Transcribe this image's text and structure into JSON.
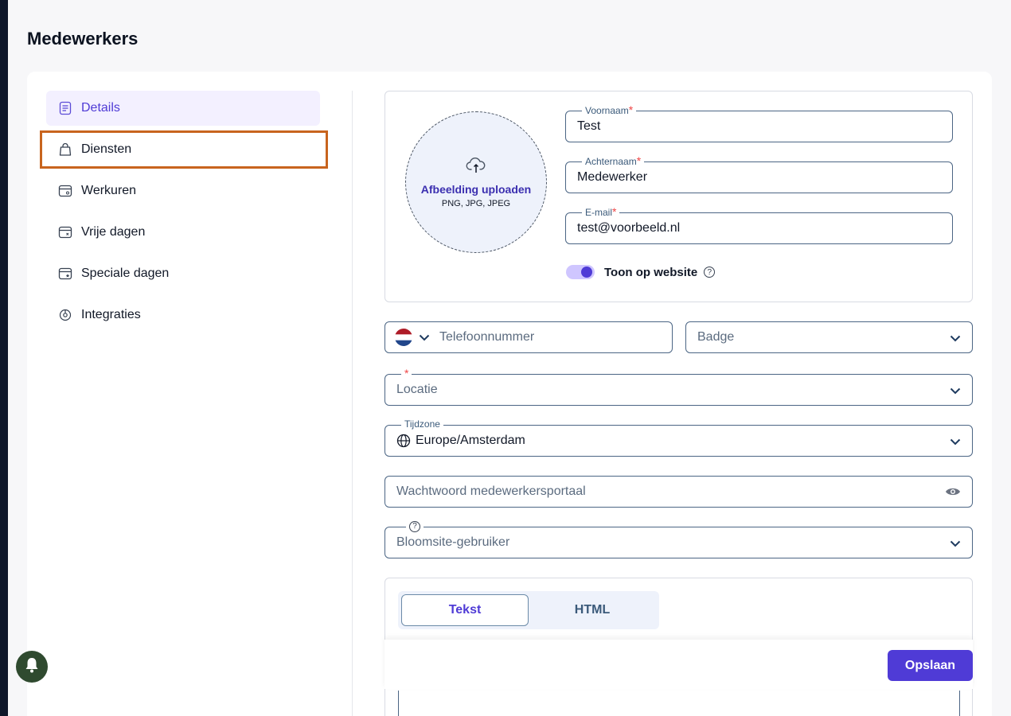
{
  "page": {
    "title": "Medewerkers"
  },
  "sidebar": {
    "items": [
      {
        "label": "Details",
        "icon": "document-icon"
      },
      {
        "label": "Diensten",
        "icon": "bag-icon"
      },
      {
        "label": "Werkuren",
        "icon": "calendar-clock-icon"
      },
      {
        "label": "Vrije dagen",
        "icon": "calendar-x-icon"
      },
      {
        "label": "Speciale dagen",
        "icon": "calendar-star-icon"
      },
      {
        "label": "Integraties",
        "icon": "integration-icon"
      }
    ]
  },
  "upload": {
    "title": "Afbeelding uploaden",
    "formats": "PNG, JPG, JPEG"
  },
  "fields": {
    "first_name": {
      "label": "Voornaam",
      "required": "*",
      "value": "Test"
    },
    "last_name": {
      "label": "Achternaam",
      "required": "*",
      "value": "Medewerker"
    },
    "email": {
      "label": "E-mail",
      "required": "*",
      "value": "test@voorbeeld.nl"
    },
    "phone": {
      "placeholder": "Telefoonnummer"
    },
    "badge": {
      "placeholder": "Badge"
    },
    "location": {
      "required": "*",
      "placeholder": "Locatie"
    },
    "timezone": {
      "label": "Tijdzone",
      "value": "Europe/Amsterdam"
    },
    "password": {
      "placeholder": "Wachtwoord medewerkersportaal"
    },
    "bloomsite_user": {
      "help": "?",
      "placeholder": "Bloomsite-gebruiker"
    }
  },
  "toggle": {
    "label": "Toon op website",
    "help": "?"
  },
  "editor": {
    "tabs": [
      "Tekst",
      "HTML"
    ]
  },
  "actions": {
    "save": "Opslaan"
  },
  "colors": {
    "accent": "#4f3bd6",
    "highlight": "#c8641e",
    "border": "#4b6584"
  }
}
